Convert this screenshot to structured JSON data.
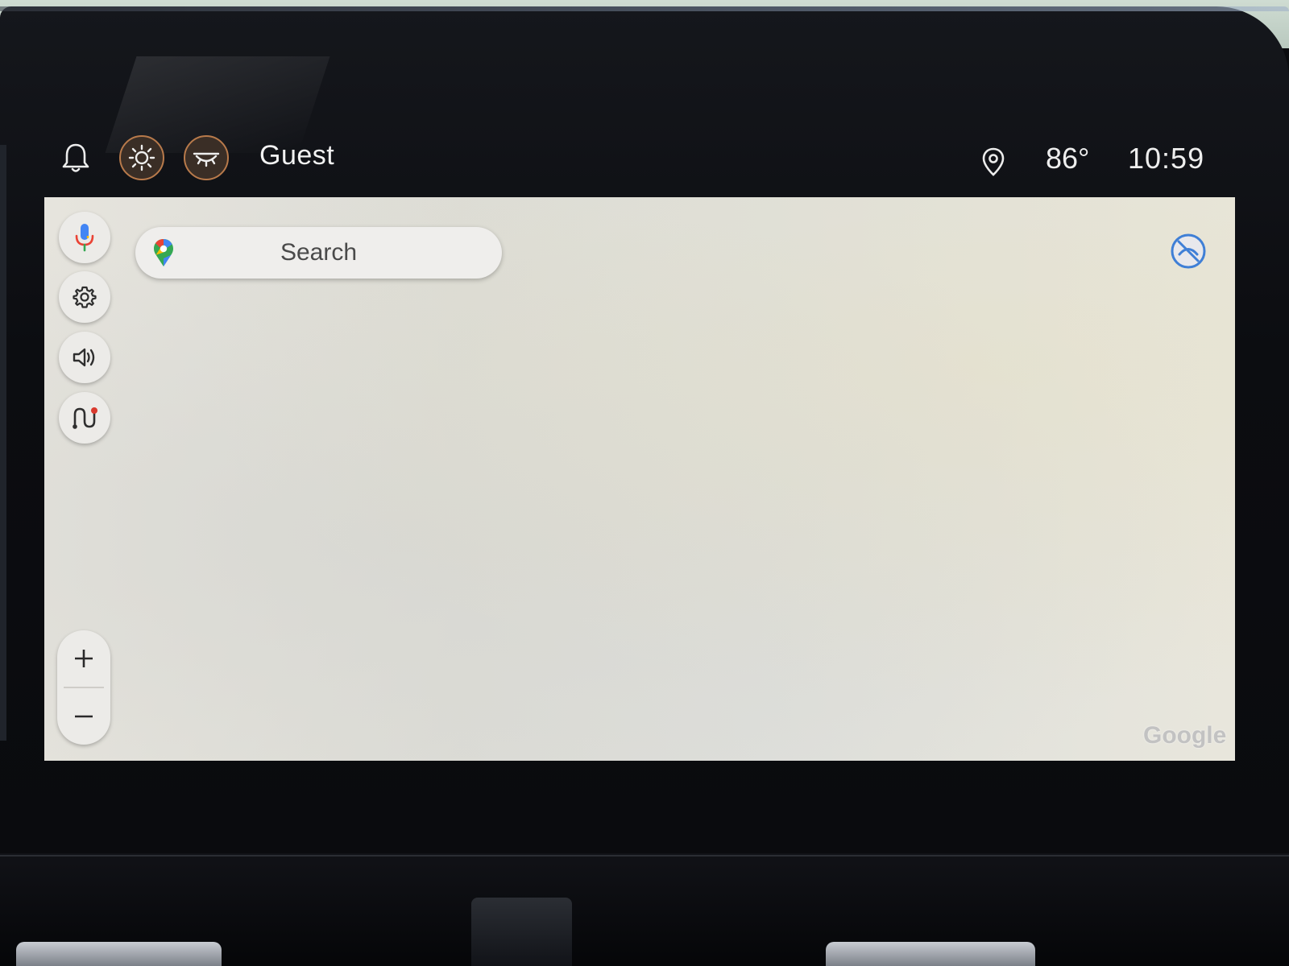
{
  "status_bar": {
    "user_name": "Guest",
    "temperature": "86°",
    "time": "10:59"
  },
  "icons": {
    "notifications": "bell-icon",
    "day_mode": "sun-icon",
    "night_mode": "eye-closed-icon",
    "location": "location-pin-icon",
    "voice": "microphone-icon",
    "settings": "gear-icon",
    "sound": "speaker-icon",
    "route": "route-icon",
    "compass": "compass-off-icon",
    "zoom_in": "plus-icon",
    "zoom_out": "minus-icon"
  },
  "map": {
    "search_placeholder": "Search",
    "watermark": "Google"
  },
  "colors": {
    "accent_ring": "#b87a4b",
    "map_background": "#e0dfd9",
    "compass_blue": "#3f7fd6",
    "route_red": "#d93a2e",
    "mic_blue": "#4285f4"
  }
}
